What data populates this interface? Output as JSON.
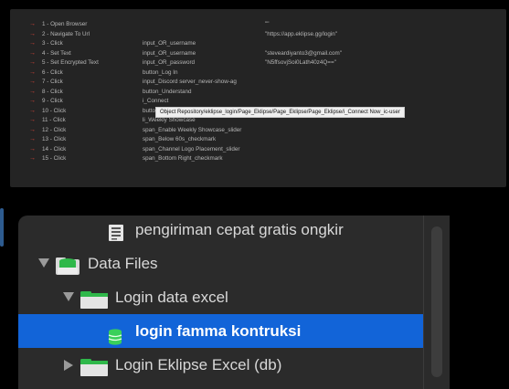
{
  "steps": [
    {
      "label": "1 - Open Browser",
      "object": "",
      "value": "\"\""
    },
    {
      "label": "2 - Navigate To Url",
      "object": "",
      "value": "\"https://app.eklipse.gg/login\""
    },
    {
      "label": "3 - Click",
      "object": "input_OR_username",
      "value": ""
    },
    {
      "label": "4 - Set Text",
      "object": "input_OR_username",
      "value": "\"steveardiyanto3@gmail.com\""
    },
    {
      "label": "5 - Set Encrypted Text",
      "object": "input_OR_password",
      "value": "\"N5ffsovjSoi0Lath40z4Q==\""
    },
    {
      "label": "6 - Click",
      "object": "button_Log In",
      "value": ""
    },
    {
      "label": "7 - Click",
      "object": "input_Discord server_never-show-ag",
      "value": ""
    },
    {
      "label": "8 - Click",
      "object": "button_Understand",
      "value": ""
    },
    {
      "label": "9 - Click",
      "object": "i_Connect",
      "value": ""
    },
    {
      "label": "10 - Click",
      "object": "button_Account settings",
      "value": ""
    },
    {
      "label": "11 - Click",
      "object": "li_Weekly Showcase",
      "value": ""
    },
    {
      "label": "12 - Click",
      "object": "span_Enable Weekly Showcase_slider",
      "value": ""
    },
    {
      "label": "13 - Click",
      "object": "span_Below 60s_checkmark",
      "value": ""
    },
    {
      "label": "14 - Click",
      "object": "span_Channel Logo Placement_slider",
      "value": ""
    },
    {
      "label": "15 - Click",
      "object": "span_Bottom Right_checkmark",
      "value": ""
    }
  ],
  "tooltip": "Object Repository/eklipse_login/Page_Eklipse/Page_Eklipse/Page_Eklipse/i_Connect Now_ic-user",
  "tree": {
    "items": [
      {
        "label": "pengiriman cepat gratis ongkir",
        "icon": "document-icon",
        "disclosure": "none",
        "selected": false
      },
      {
        "label": "Data Files",
        "icon": "data-folder-icon",
        "disclosure": "expanded",
        "selected": false
      },
      {
        "label": "Login data excel",
        "icon": "folder-icon",
        "disclosure": "expanded",
        "selected": false
      },
      {
        "label": "login famma kontruksi",
        "icon": "database-icon",
        "disclosure": "none",
        "selected": true
      },
      {
        "label": "Login Eklipse Excel (db)",
        "icon": "folder-icon",
        "disclosure": "collapsed",
        "selected": false
      }
    ]
  },
  "colors": {
    "step_arrow": "#d9463a",
    "selection": "#1264d8",
    "panel_dark": "#242424",
    "tree_bg": "#2b2b2b"
  }
}
